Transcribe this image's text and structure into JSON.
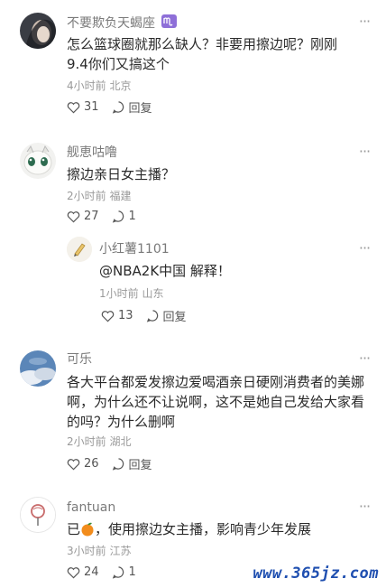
{
  "comments": [
    {
      "username": "不要欺负天蝎座",
      "text": "怎么篮球圈就那么缺人？非要用擦边呢？刚刚9.4你们又搞这个",
      "meta": "4小时前 北京",
      "likes": "31",
      "reply_label": "回复"
    },
    {
      "username": "舰恵咕噜",
      "text": "擦边亲日女主播？",
      "meta": "2小时前 福建",
      "likes": "27",
      "replies": "1",
      "reply": {
        "username": "小红薯1101",
        "text": "@NBA2K中国 解释！",
        "meta": "1小时前 山东",
        "likes": "13",
        "reply_label": "回复"
      }
    },
    {
      "username": "可乐",
      "text": "各大平台都爱发擦边爱喝酒亲日硬刚消费者的美娜啊，为什么还不让说啊，这不是她自己发给大家看的吗？为什么删啊",
      "meta": "2小时前 湖北",
      "likes": "26",
      "reply_label": "回复"
    },
    {
      "username": "fantuan",
      "text_prefix": "已",
      "text_suffix": "，使用擦边女主播，影响青少年发展",
      "meta": "3小时前 江苏",
      "likes": "24",
      "replies": "1"
    }
  ],
  "more_icon": "ellipsis-icon",
  "watermark": "www.365jz.com"
}
